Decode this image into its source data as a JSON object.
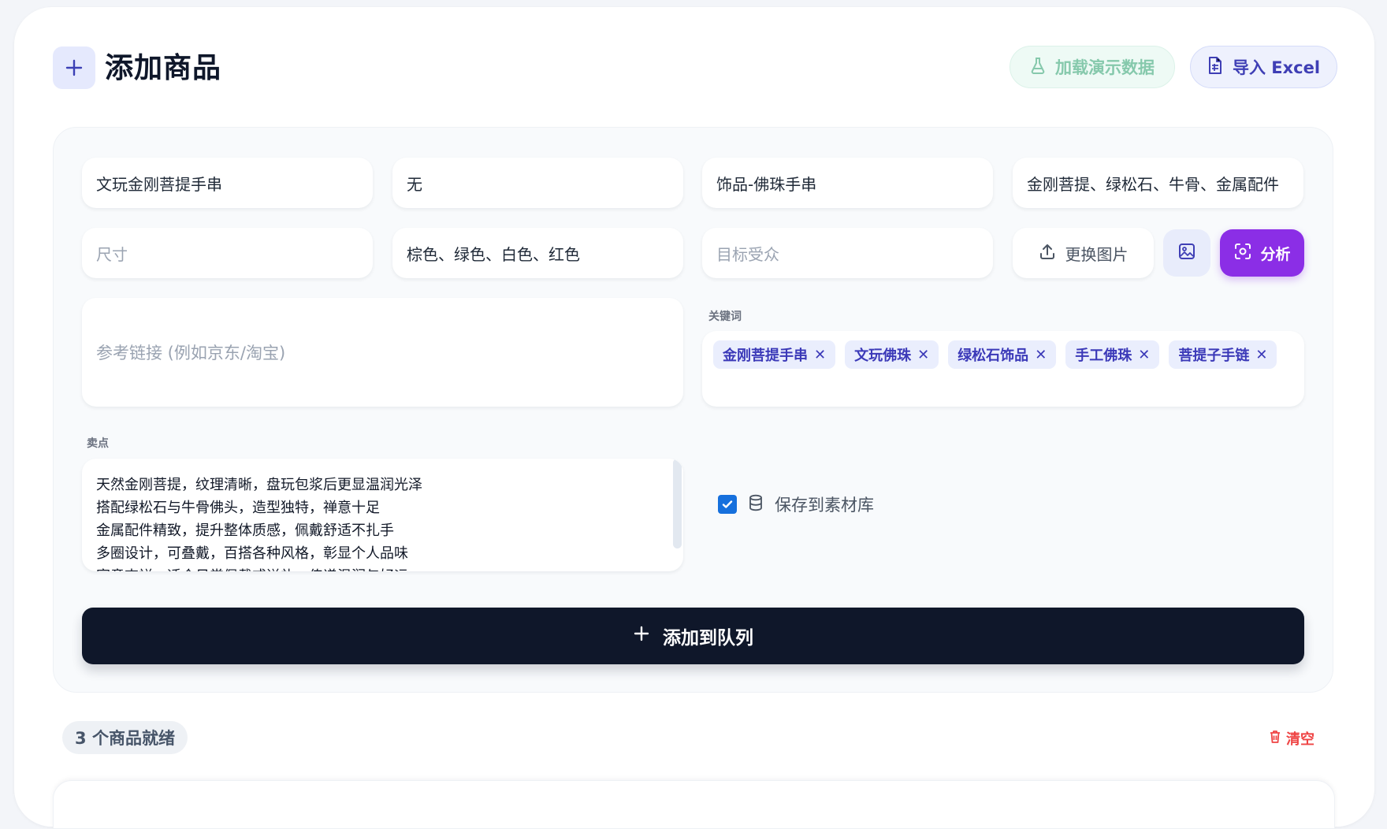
{
  "header": {
    "title": "添加商品",
    "demo_label": "加载演示数据",
    "excel_label": "导入 Excel"
  },
  "form": {
    "name_value": "文玩金刚菩提手串",
    "brand_value": "无",
    "category_value": "饰品-佛珠手串",
    "material_value": "金刚菩提、绿松石、牛骨、金属配件",
    "size_placeholder": "尺寸",
    "color_value": "棕色、绿色、白色、红色",
    "audience_placeholder": "目标受众",
    "replace_image_label": "更换图片",
    "analyze_label": "分析",
    "reference_placeholder": "参考链接 (例如京东/淘宝)",
    "keywords_label": "关键词",
    "keywords": [
      "金刚菩提手串",
      "文玩佛珠",
      "绿松石饰品",
      "手工佛珠",
      "菩提子手链"
    ],
    "selling_points_label": "卖点",
    "selling_points": [
      "天然金刚菩提，纹理清晰，盘玩包浆后更显温润光泽",
      "搭配绿松石与牛骨佛头，造型独特，禅意十足",
      "金属配件精致，提升整体质感，佩戴舒适不扎手",
      "多圈设计，可叠戴，百搭各种风格，彰显个人品味",
      "寓意吉祥，适合日常佩戴或送礼，传递温润与好运"
    ],
    "save_label": "保存到素材库",
    "save_checked": true,
    "add_queue_label": "添加到队列"
  },
  "queue": {
    "ready_text": "3 个商品就绪",
    "clear_label": "清空"
  },
  "colors": {
    "accent_purple": "#8b2ee6",
    "dark_button": "#0f172a",
    "keyword_text": "#3b39b8",
    "danger": "#ef4444"
  }
}
